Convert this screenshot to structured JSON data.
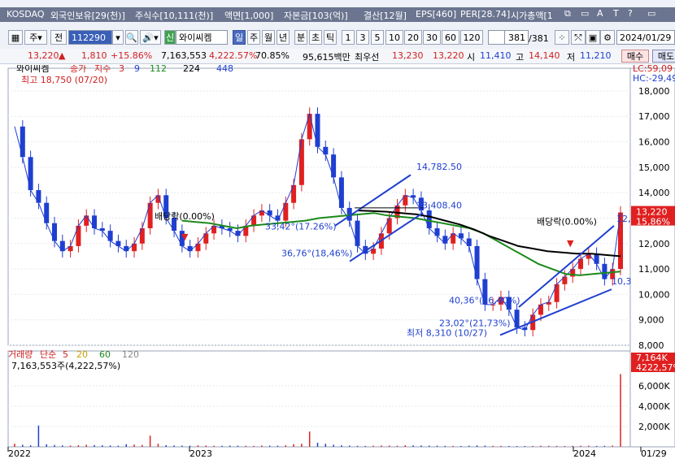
{
  "header": {
    "market": "KOSDAQ",
    "foreign_limit": "외국인보유[29(천)]",
    "shares": "주식수[10,111(천)]",
    "face_value": "액면[1,000]",
    "capital": "자본금[103(억)]",
    "settlement": "결산[12월]",
    "eps": "EPS[460]",
    "per": "PER[28.74]",
    "market_cap": "시가총액[1"
  },
  "toolbar": {
    "stock_code": "112290",
    "stock_name": "와이씨켐",
    "prefix1": "주",
    "prefix2": "전",
    "badge": "신",
    "periods": [
      "일",
      "주",
      "월",
      "년",
      "분",
      "초",
      "틱"
    ],
    "intervals": [
      "1",
      "3",
      "5",
      "10",
      "20",
      "30",
      "60",
      "120"
    ],
    "page_current": "381",
    "page_total": "/381",
    "date": "2024/01/29"
  },
  "quote": {
    "price": "13,220",
    "arrow": "▲",
    "change": "1,810",
    "change_pct": "+15.86%",
    "volume": "7,163,553",
    "volume_pct": "4,222.57%",
    "ratio": "70.85%",
    "amount": "95,615백만",
    "best_ask_label": "최우선",
    "best_ask": "13,230",
    "best_bid": "13,220",
    "open_label": "시",
    "open": "11,410",
    "high_label": "고",
    "high": "14,140",
    "low_label": "저",
    "low": "11,210",
    "buy_button": "매수",
    "sell_button": "매도"
  },
  "chart_data": {
    "type": "line",
    "title": "와이씨켐",
    "legend": [
      "종가",
      "지수",
      "3",
      "9",
      "112",
      "224",
      "448"
    ],
    "legend_colors": [
      "#d02020",
      "#d02020",
      "#d02020",
      "#1f3fd0",
      "#1a8a1a",
      "#000000",
      "#1f3fd0"
    ],
    "high_label": "최고 18,750 (07/20)",
    "low_label": "최저 8,310 (10/27)",
    "ylim": [
      8000,
      18700
    ],
    "y_ticks": [
      "18,000",
      "17,000",
      "16,000",
      "15,000",
      "14,000",
      "13,000",
      "12,000",
      "11,000",
      "10,000",
      "9,000",
      "8,000"
    ],
    "x_ticks": [
      "2022",
      "2023",
      "2024",
      "01/29"
    ],
    "right_labels": {
      "lc": "LC:59,09",
      "hc": "HC:-29,49",
      "last_price": "13,220",
      "last_pct": "15,86%"
    },
    "annotations": {
      "dividend1": "배당락(0.00%)",
      "dividend2": "배당락(0.00%)",
      "t1": "14,782.50",
      "t2": "13,408.40",
      "t3": "33,42°(17.26%)",
      "t4": "36,76°(18,46%)",
      "t5": "40,36°(36,40%)",
      "t6": "23,02°(21,73%)",
      "t7": "12,",
      "t8": "10,3"
    },
    "series": [
      {
        "name": "종가",
        "color": "#d02020",
        "values": [
          16600,
          15400,
          14100,
          13600,
          12800,
          12100,
          11700,
          11900,
          12700,
          13100,
          12600,
          12500,
          12100,
          11900,
          11700,
          12000,
          12600,
          13600,
          13900,
          13000,
          12500,
          11900,
          11700,
          12000,
          12400,
          12700,
          12600,
          12500,
          12300,
          12700,
          13100,
          13300,
          13100,
          12900,
          13600,
          14300,
          16100,
          17100,
          15800,
          15500,
          14600,
          13400,
          12900,
          11900,
          11600,
          11800,
          12400,
          13000,
          13500,
          13900,
          13800,
          13300,
          12600,
          12300,
          12000,
          12400,
          12200,
          11900,
          10600,
          9600,
          9600,
          9900,
          9400,
          8700,
          8600,
          9200,
          9600,
          9700,
          10400,
          10700,
          11000,
          11400,
          11600,
          11200,
          10600,
          11000,
          13220
        ]
      },
      {
        "name": "112",
        "color": "#1a8a1a",
        "values": [
          12900,
          12850,
          12800,
          12700,
          12600,
          12700,
          12750,
          12800,
          12850,
          12900,
          13000,
          13050,
          13100,
          13150,
          13200,
          13100,
          13050,
          13000,
          12900,
          12800,
          12700,
          12600,
          12400,
          12100,
          11800,
          11500,
          11200,
          11000,
          10800,
          10750,
          10800,
          10850,
          10900
        ]
      },
      {
        "name": "224",
        "color": "#000000",
        "values": [
          13300,
          13280,
          13250,
          13200,
          13150,
          13050,
          12900,
          12750,
          12550,
          12300,
          12100,
          11900,
          11800,
          11700,
          11650,
          11600,
          11600,
          11550,
          11500
        ]
      }
    ],
    "volume_panel": {
      "legend": [
        "거래량",
        "단순",
        "5",
        "20",
        "60",
        "120"
      ],
      "legend_colors": [
        "#d02020",
        "#d02020",
        "#d02020",
        "#c8a000",
        "#1a8a1a",
        "#888888"
      ],
      "volume_label": "7,163,553주(4,222,57%)",
      "y_ticks": [
        "6,000K",
        "4,000K",
        "2,000K"
      ],
      "last_label": "7,164K",
      "last_pct": "4222,57%",
      "values": [
        300,
        200,
        150,
        2100,
        250,
        180,
        140,
        120,
        160,
        200,
        170,
        150,
        130,
        110,
        260,
        220,
        180,
        1100,
        300,
        160,
        130,
        120,
        110,
        150,
        130,
        110,
        100,
        120,
        110,
        100,
        90,
        130,
        120,
        110,
        150,
        260,
        300,
        1500,
        400,
        300,
        200,
        150,
        120,
        100,
        90,
        110,
        130,
        120,
        110,
        160,
        140,
        130,
        120,
        110,
        100,
        90,
        80,
        110,
        140,
        120,
        100,
        90,
        80,
        70,
        80,
        90,
        110,
        100,
        90,
        80,
        90,
        100,
        110,
        90,
        100,
        120,
        7164
      ]
    }
  }
}
